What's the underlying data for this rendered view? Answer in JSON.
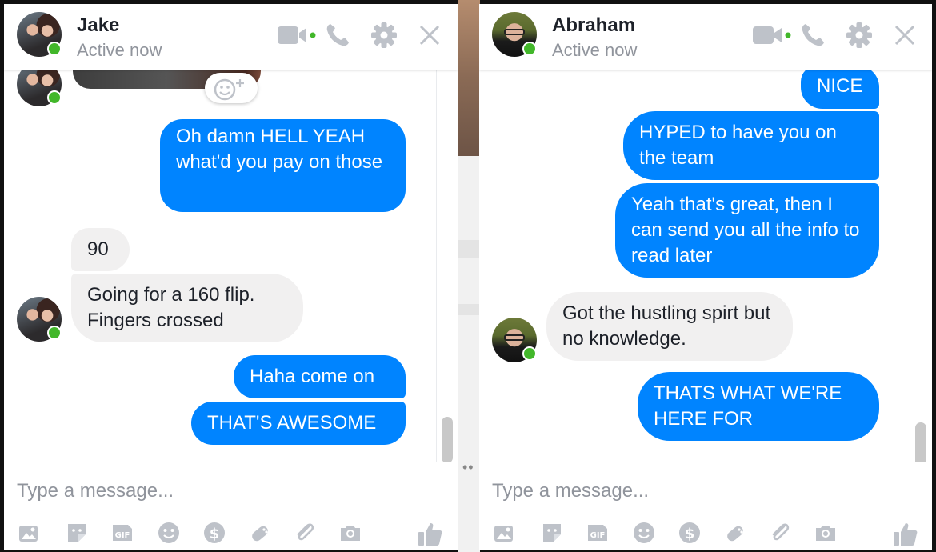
{
  "chats": [
    {
      "contact": {
        "name": "Jake",
        "status": "Active now"
      },
      "messages": [
        {
          "text": "Oh damn HELL YEAH what'd you pay on those",
          "direction": "out"
        },
        {
          "text": "90",
          "direction": "in"
        },
        {
          "text": "Going for a 160 flip. Fingers crossed",
          "direction": "in"
        },
        {
          "text": "Haha come on",
          "direction": "out"
        },
        {
          "text": "THAT'S AWESOME",
          "direction": "out"
        }
      ],
      "composer": {
        "placeholder": "Type a message..."
      }
    },
    {
      "contact": {
        "name": "Abraham",
        "status": "Active now"
      },
      "messages": [
        {
          "text": "NICE",
          "direction": "out"
        },
        {
          "text": "HYPED to have you on the team",
          "direction": "out"
        },
        {
          "text": "Yeah that's great, then I can send you all the info to read later",
          "direction": "out"
        },
        {
          "text": "Got the hustling spirt but no knowledge.",
          "direction": "in"
        },
        {
          "text": "THATS WHAT WE'RE HERE FOR",
          "direction": "out"
        }
      ],
      "composer": {
        "placeholder": "Type a message..."
      }
    }
  ],
  "header_icons": [
    "video-call-icon",
    "phone-icon",
    "gear-icon",
    "close-icon"
  ],
  "composer_tools": [
    "photo-icon",
    "sticker-icon",
    "gif-icon",
    "emoji-icon",
    "payment-icon",
    "game-icon",
    "attachment-icon",
    "camera-icon",
    "like-icon"
  ],
  "colors": {
    "outgoing": "#0084ff",
    "incoming": "#f1f0f0",
    "online": "#42b72a",
    "icon": "#bec2c9"
  }
}
